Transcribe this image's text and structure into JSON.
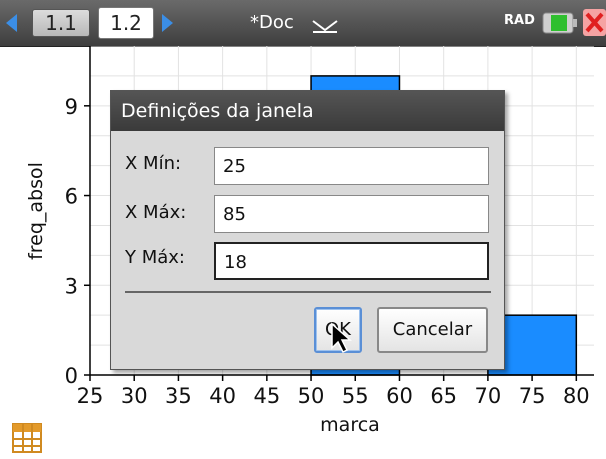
{
  "topbar": {
    "tabs": [
      {
        "label": "1.1"
      },
      {
        "label": "1.2"
      }
    ],
    "doc_title": "*Doc",
    "mode": "RAD"
  },
  "chart_data": {
    "type": "bar",
    "xlabel": "marca",
    "ylabel": "freq_absol",
    "xlim": [
      25,
      82
    ],
    "ylim": [
      0,
      11
    ],
    "x_ticks": [
      25,
      30,
      35,
      40,
      45,
      50,
      55,
      60,
      65,
      70,
      75,
      80
    ],
    "y_ticks": [
      0,
      3,
      6,
      9
    ],
    "bars": [
      {
        "x0": 50,
        "x1": 60,
        "value": 10
      },
      {
        "x0": 70,
        "x1": 80,
        "value": 2
      }
    ],
    "bar_color": "#1a8cff"
  },
  "dialog": {
    "title": "Definições da janela",
    "fields": [
      {
        "label": "X Mín:",
        "value": "25"
      },
      {
        "label": "X Máx:",
        "value": "85"
      },
      {
        "label": "Y Máx:",
        "value": "18"
      }
    ],
    "ok_label": "OK",
    "cancel_label": "Cancelar"
  },
  "icons": {
    "battery": "battery-icon",
    "close": "close-icon",
    "list": "list-icon"
  }
}
